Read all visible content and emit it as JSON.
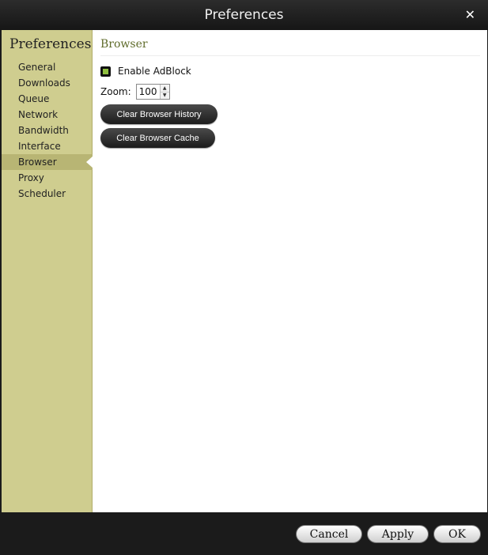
{
  "window": {
    "title": "Preferences",
    "close_glyph": "✕"
  },
  "sidebar": {
    "title": "Preferences",
    "items": [
      {
        "label": "General"
      },
      {
        "label": "Downloads"
      },
      {
        "label": "Queue"
      },
      {
        "label": "Network"
      },
      {
        "label": "Bandwidth"
      },
      {
        "label": "Interface"
      },
      {
        "label": "Browser"
      },
      {
        "label": "Proxy"
      },
      {
        "label": "Scheduler"
      }
    ],
    "active": "Browser"
  },
  "browser": {
    "section_title": "Browser",
    "adblock": {
      "label": "Enable AdBlock",
      "checked": true
    },
    "zoom": {
      "label": "Zoom:",
      "value": "100"
    },
    "clear_history_label": "Clear Browser History",
    "clear_cache_label": "Clear Browser Cache"
  },
  "footer": {
    "cancel_label": "Cancel",
    "apply_label": "Apply",
    "ok_label": "OK"
  },
  "colors": {
    "sidebar_bg": "#cfcd8f",
    "sidebar_active": "#b8b574",
    "section_title": "#5f6b2a",
    "window_chrome": "#1b1b1b"
  }
}
